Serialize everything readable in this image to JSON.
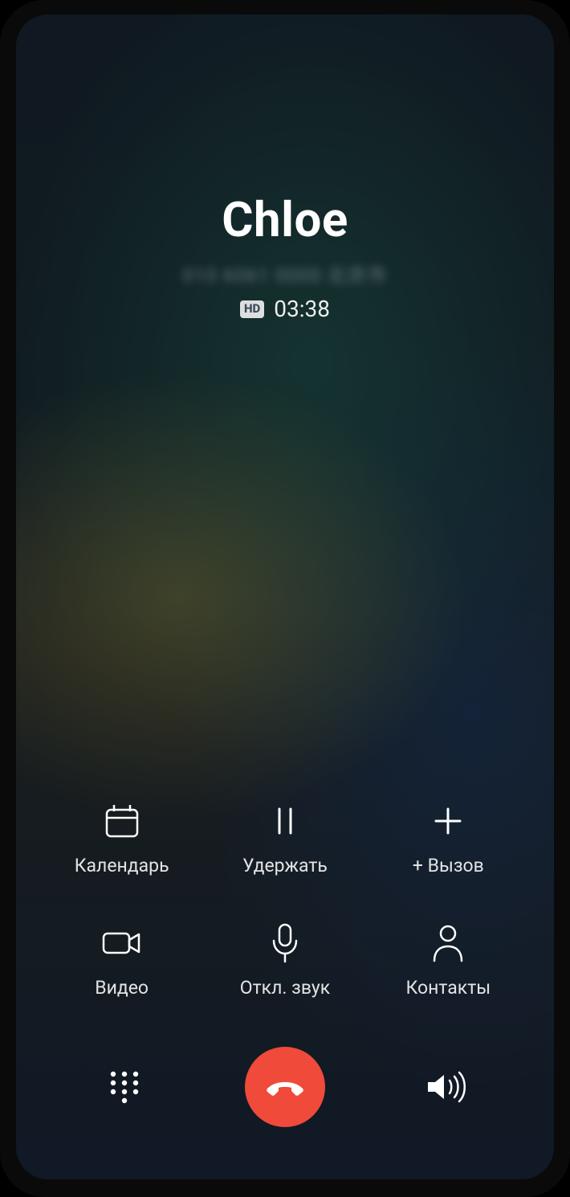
{
  "caller": {
    "name": "Chloe",
    "blurred_subtitle": "010 6061 0000 北京市",
    "hd_label": "HD",
    "duration": "03:38"
  },
  "controls": {
    "calendar": "Календарь",
    "hold": "Удержать",
    "add_call": "+ Вызов",
    "video": "Видео",
    "mute": "Откл. звук",
    "contacts": "Контакты"
  },
  "colors": {
    "end_call": "#f04a3a"
  }
}
